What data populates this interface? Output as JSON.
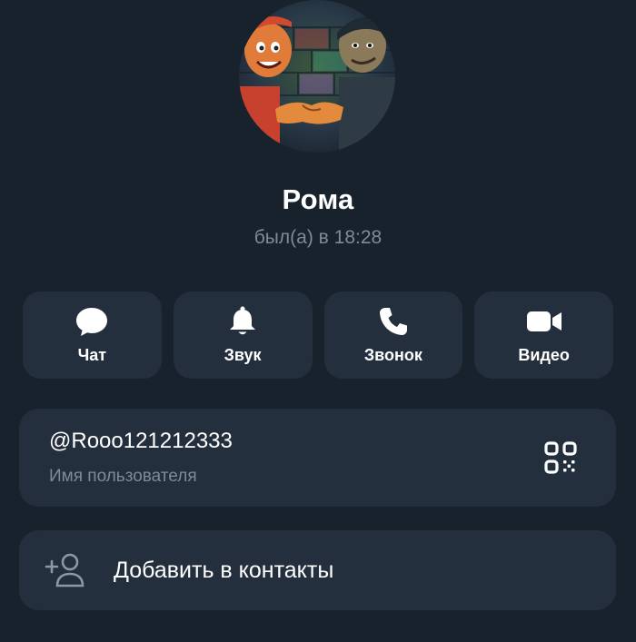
{
  "profile": {
    "name": "Рома",
    "status": "был(а) в 18:28",
    "avatar_icon": "avatar-image"
  },
  "actions": [
    {
      "label": "Чат",
      "icon": "chat-bubble-icon"
    },
    {
      "label": "Звук",
      "icon": "bell-icon"
    },
    {
      "label": "Звонок",
      "icon": "phone-icon"
    },
    {
      "label": "Видео",
      "icon": "video-camera-icon"
    }
  ],
  "username_card": {
    "username": "@Rooo121212333",
    "caption": "Имя пользователя",
    "qr_icon": "qr-code-icon"
  },
  "add_contact": {
    "label": "Добавить в контакты",
    "icon": "add-user-icon"
  },
  "colors": {
    "background": "#18222d",
    "card": "#242f3d",
    "secondary_text": "#7d8b99",
    "primary_text": "#ffffff"
  }
}
